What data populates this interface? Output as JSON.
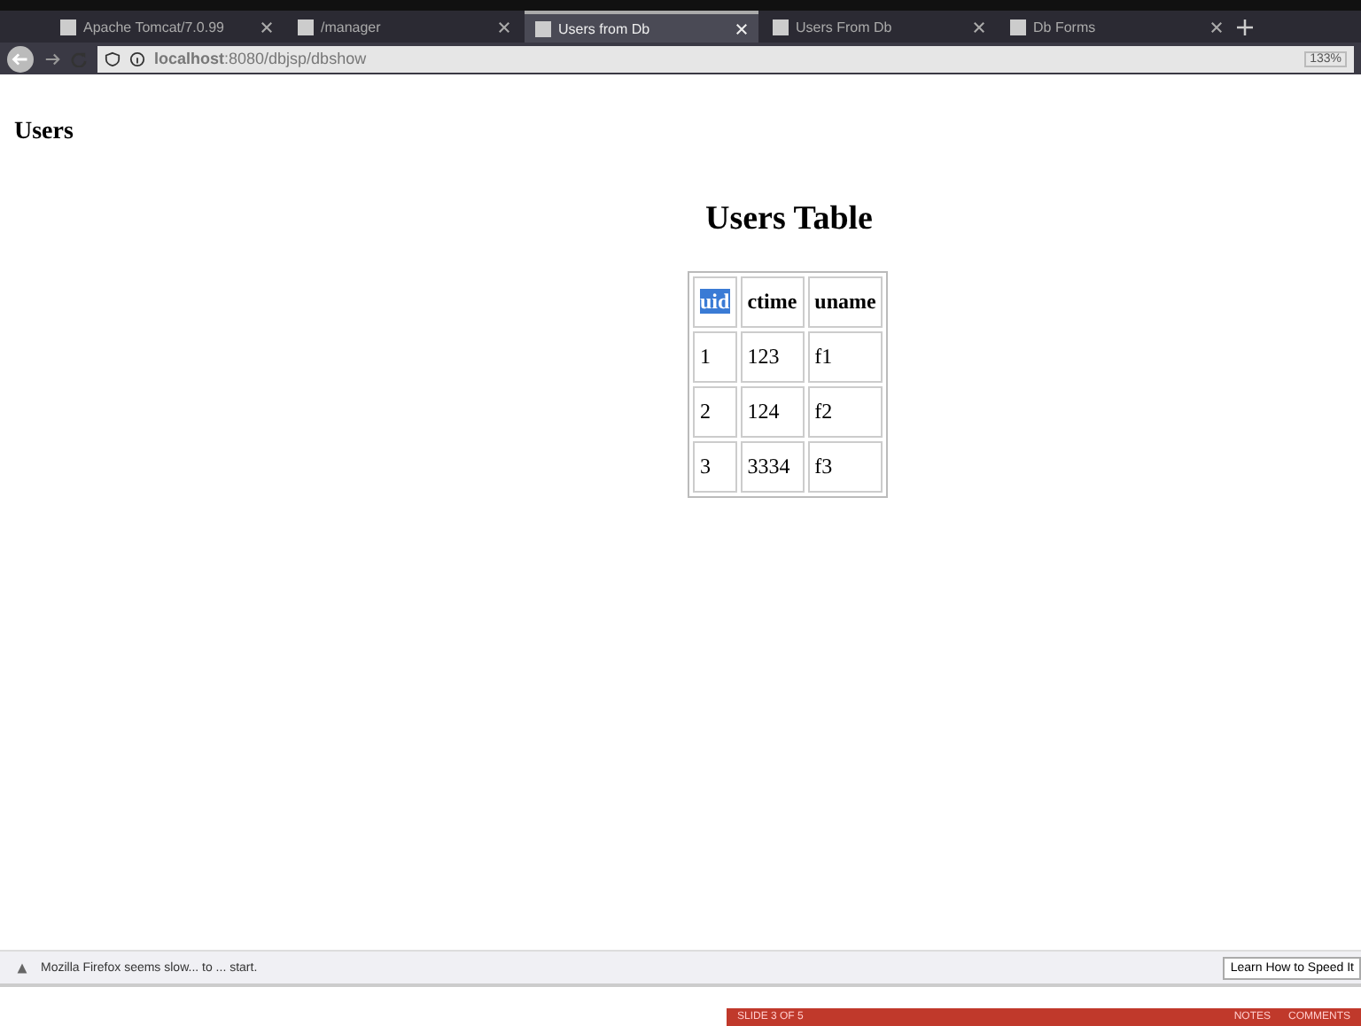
{
  "tabs": [
    {
      "label": "Apache Tomcat/7.0.99",
      "selected": false
    },
    {
      "label": "/manager",
      "selected": false
    },
    {
      "label": "Users from Db",
      "selected": true
    },
    {
      "label": "Users From Db",
      "selected": false
    },
    {
      "label": "Db Forms",
      "selected": false
    }
  ],
  "address_bar": {
    "url": "**localhost**:8080/dbjsp/dbshow",
    "zoom": "133%"
  },
  "page": {
    "heading": "Users",
    "table_title": "Users Table",
    "table": {
      "columns": [
        {
          "label": "uid",
          "selected": true
        },
        {
          "label": "ctime",
          "selected": false
        },
        {
          "label": "uname",
          "selected": false
        }
      ],
      "rows": [
        [
          "1",
          "123",
          "f1"
        ],
        [
          "2",
          "124",
          "f2"
        ],
        [
          "3",
          "3334",
          "f3"
        ]
      ]
    }
  },
  "notification": {
    "message": "Mozilla Firefox seems slow... to ... start.",
    "button": "Learn How to Speed It"
  },
  "status_bar": {
    "slide": "SLIDE 3 OF 5",
    "notes": "NOTES",
    "comments": "COMMENTS"
  }
}
